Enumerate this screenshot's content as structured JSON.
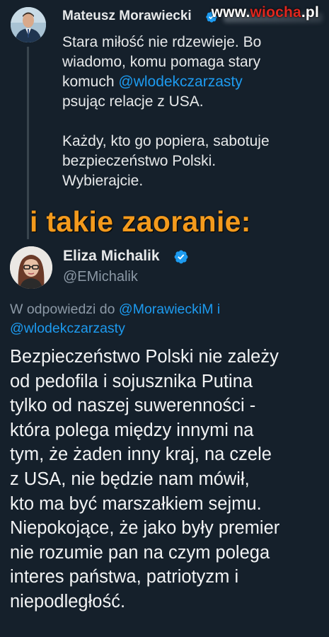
{
  "watermark": {
    "prefix": "www.",
    "brand": "wiocha",
    "suffix": ".pl"
  },
  "tweet1": {
    "author_name": "Mateusz Morawiecki",
    "verified_icon": "verified-badge-icon",
    "lines": [
      "Stara miłość nie rdzewieje. Bo",
      "wiadomo, komu pomaga stary"
    ],
    "line3_prefix": "komuch ",
    "line3_mention": "@wlodekczarzasty",
    "line4": "psując relacje z USA.",
    "lines2": [
      "Każdy, kto go popiera, sabotuje",
      "bezpieczeństwo Polski.",
      "Wybierajcie."
    ]
  },
  "overlay_caption": "i takie zaoranie:",
  "tweet2": {
    "author_name": "Eliza Michalik",
    "handle": "@EMichalik",
    "verified_icon": "verified-badge-icon",
    "reply_prefix": "W odpowiedzi do ",
    "reply_mention1": "@MorawieckiM",
    "reply_joiner": " i",
    "reply_mention2": "@wlodekczarzasty",
    "body_lines": [
      "Bezpieczeństwo Polski nie zależy",
      "od pedofila i sojusznika Putina",
      "tylko od naszej suwerenności -",
      "która polega między innymi na",
      "tym, że żaden inny kraj, na czele",
      "z USA, nie będzie nam mówił,",
      "kto ma być marszałkiem sejmu.",
      "Niepokojące, że jako były premier",
      "nie rozumie pan na czym polega",
      "interes państwa, patriotyzm i",
      "niepodległość."
    ]
  },
  "colors": {
    "background": "#15202b",
    "text": "#e7e9ea",
    "secondary": "#8b98a5",
    "link": "#1d9bf0",
    "caption": "#f39a1d",
    "watermark_accent": "#e0271f"
  }
}
